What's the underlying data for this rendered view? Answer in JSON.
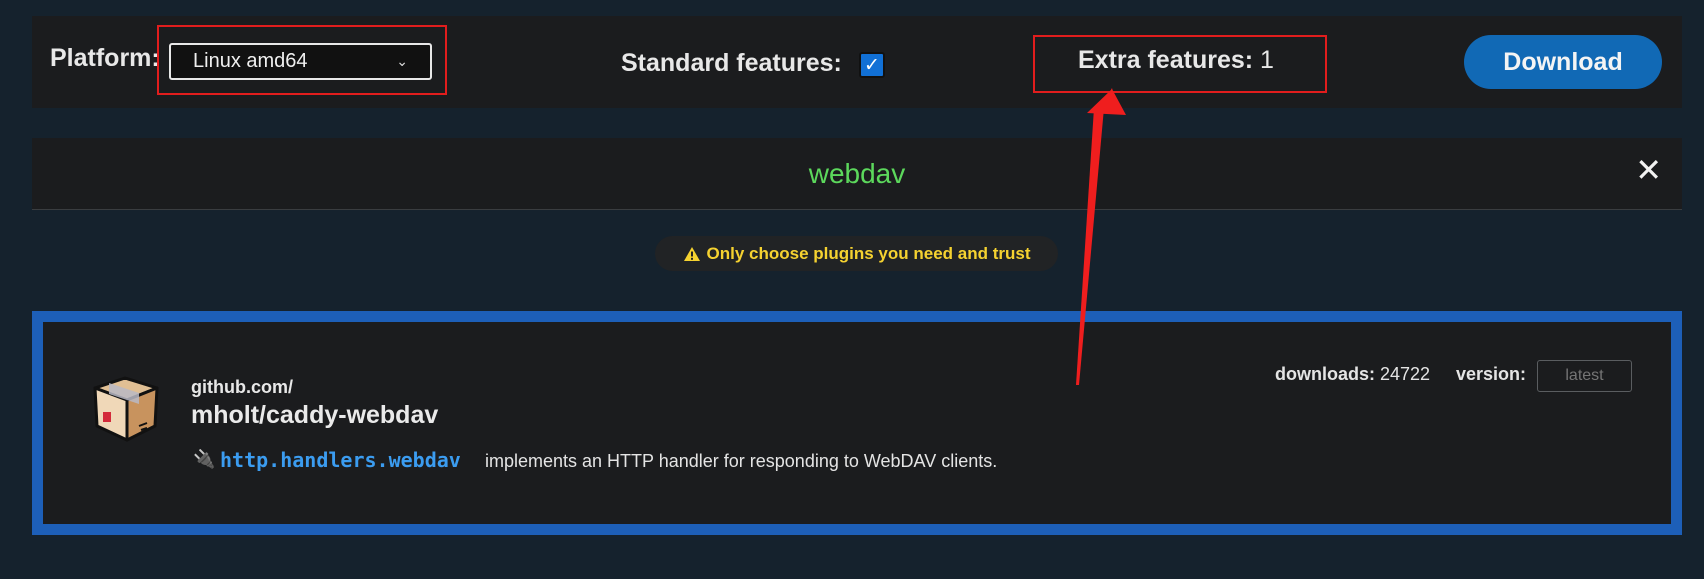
{
  "toolbar": {
    "platform_label": "Platform:",
    "platform_value": "Linux amd64",
    "standard_features_label": "Standard features:",
    "standard_features_checked": true,
    "extra_features_label": "Extra features:",
    "extra_features_count": "1",
    "download_label": "Download"
  },
  "search": {
    "query": "webdav",
    "clear_icon": "close-icon"
  },
  "warning": {
    "icon": "warning-triangle-icon",
    "text": "Only choose plugins you need and trust"
  },
  "plugin": {
    "icon": "package-box-icon",
    "module_prefix": "github.com/",
    "module_name": "mholt/caddy-webdav",
    "downloads_label": "downloads:",
    "downloads_value": "24722",
    "version_label": "version:",
    "version_placeholder": "latest",
    "handler_icon": "plug-icon",
    "handler_name": "http.handlers.webdav",
    "handler_description": "implements an HTTP handler for responding to WebDAV clients."
  },
  "colors": {
    "accent_blue": "#1169b5",
    "card_border": "#1d5fb8",
    "search_green": "#5cd85c",
    "warning_yellow": "#f5d230",
    "annotation_red": "#e21d1d"
  }
}
